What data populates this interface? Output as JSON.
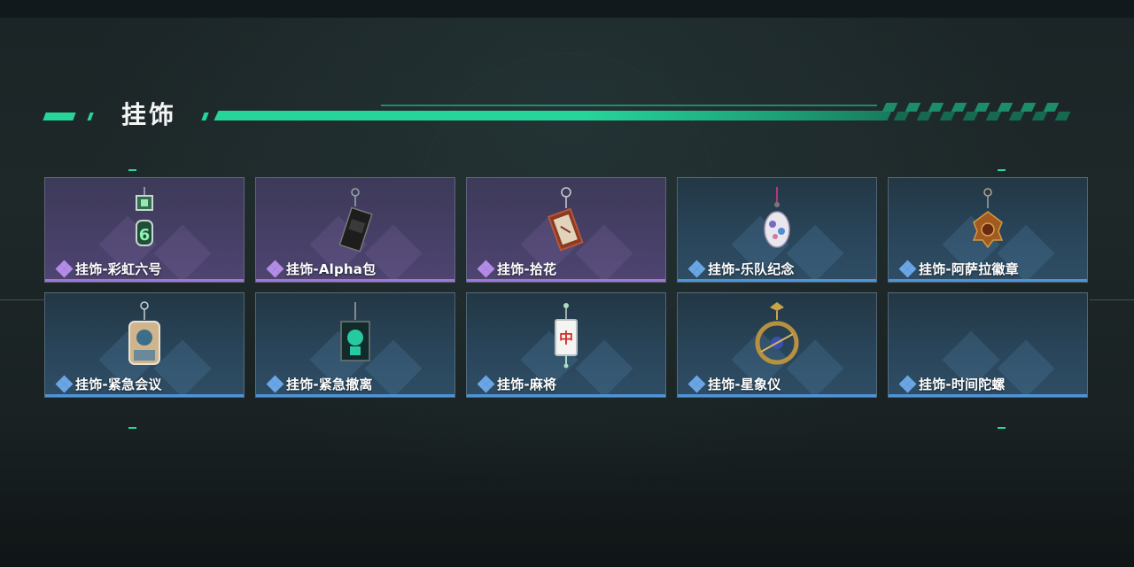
{
  "section": {
    "title": "挂饰"
  },
  "colors": {
    "accent": "#25d59a",
    "purple_tier": "#a176d8",
    "blue_tier": "#4f94d8"
  },
  "items": [
    {
      "label": "挂饰-彩虹六号",
      "rarity": "purple",
      "icon": "rainbow-six-charm-icon"
    },
    {
      "label": "挂饰-Alpha包",
      "rarity": "purple",
      "icon": "alpha-bag-charm-icon"
    },
    {
      "label": "挂饰-拾花",
      "rarity": "purple",
      "icon": "picked-flower-charm-icon"
    },
    {
      "label": "挂饰-乐队纪念",
      "rarity": "blue",
      "icon": "band-souvenir-charm-icon"
    },
    {
      "label": "挂饰-阿萨拉徽章",
      "rarity": "blue",
      "icon": "asara-badge-charm-icon"
    },
    {
      "label": "挂饰-紧急会议",
      "rarity": "blue",
      "icon": "emergency-meeting-charm-icon"
    },
    {
      "label": "挂饰-紧急撤离",
      "rarity": "blue",
      "icon": "emergency-evac-charm-icon"
    },
    {
      "label": "挂饰-麻将",
      "rarity": "blue",
      "icon": "mahjong-charm-icon",
      "tile_char": "中"
    },
    {
      "label": "挂饰-星象仪",
      "rarity": "blue",
      "icon": "astrolabe-charm-icon"
    },
    {
      "label": "挂饰-时间陀螺",
      "rarity": "blue",
      "icon": "time-gyro-charm-icon"
    }
  ]
}
